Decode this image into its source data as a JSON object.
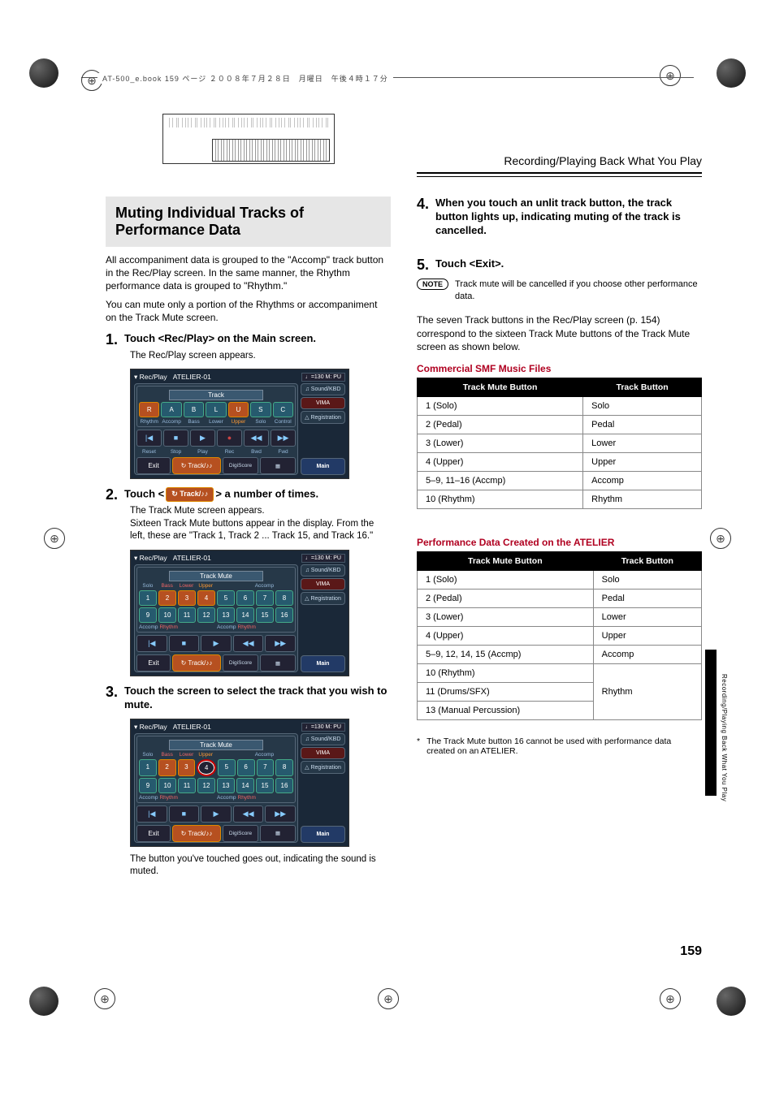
{
  "print_header": "AT-500_e.book  159 ページ  ２００８年７月２８日　月曜日　午後４時１７分",
  "running_head": "Recording/Playing Back What You Play",
  "side_tab_text": "Recording/Playing Back What You Play",
  "page_number": "159",
  "left": {
    "section_title": "Muting Individual Tracks of Performance Data",
    "intro1": "All accompaniment data is grouped to the \"Accomp\" track button in the Rec/Play screen. In the same manner, the Rhythm performance data is grouped to \"Rhythm.\"",
    "intro2": "You can mute only a portion of the Rhythms or accompaniment on the Track Mute screen.",
    "step1_text": "Touch <Rec/Play> on the Main screen.",
    "step1_sub": "The Rec/Play screen appears.",
    "step2_pre": "Touch <",
    "step2_chip": "↻ Track/♪♪",
    "step2_post": "> a number of times.",
    "step2_sub1": "The Track Mute screen appears.",
    "step2_sub2": "Sixteen Track Mute buttons appear in the display. From the left, these are \"Track 1, Track 2 ... Track 15, and Track 16.\"",
    "step3_text": "Touch the screen to select the track that you wish to mute.",
    "step3_sub": "The button you've touched goes out, indicating the sound is muted."
  },
  "right": {
    "step4_text": "When you touch an unlit track button, the track button lights up, indicating muting of the track is cancelled.",
    "step5_text": "Touch <Exit>.",
    "note_label": "NOTE",
    "note_text": "Track mute will be cancelled if you choose other performance data.",
    "mid_para": "The seven Track buttons in the Rec/Play screen (p. 154) correspond to the sixteen Track Mute buttons of the Track Mute screen as shown below.",
    "table1_title": "Commercial SMF Music Files",
    "th_mute": "Track Mute Button",
    "th_button": "Track Button",
    "t1": {
      "r1c1": "1 (Solo)",
      "r1c2": "Solo",
      "r2c1": "2 (Pedal)",
      "r2c2": "Pedal",
      "r3c1": "3 (Lower)",
      "r3c2": "Lower",
      "r4c1": "4 (Upper)",
      "r4c2": "Upper",
      "r5c1": "5–9, 11–16 (Accmp)",
      "r5c2": "Accomp",
      "r6c1": "10 (Rhythm)",
      "r6c2": "Rhythm"
    },
    "table2_title": "Performance Data Created on the ATELIER",
    "t2": {
      "r1c1": "1 (Solo)",
      "r1c2": "Solo",
      "r2c1": "2 (Pedal)",
      "r2c2": "Pedal",
      "r3c1": "3 (Lower)",
      "r3c2": "Lower",
      "r4c1": "4 (Upper)",
      "r4c2": "Upper",
      "r5c1": "5–9, 12, 14, 15 (Accmp)",
      "r5c2": "Accomp",
      "r6c1": "10 (Rhythm)",
      "r7c1": "11 (Drums/SFX)",
      "r67c2": "Rhythm",
      "r8c1": "13 (Manual Percussion)"
    },
    "foot_star": "*",
    "foot_text": "The Track Mute button 16 cannot be used with performance data created on an ATELIER."
  },
  "shot1": {
    "title_l": "Rec/Play",
    "title_r": "ATELIER-01",
    "tempo": "♩=130\nM:  PU",
    "track_label": "Track",
    "btns": [
      "R",
      "A",
      "B",
      "L",
      "U",
      "S",
      "C"
    ],
    "lbls": [
      "Rhythm",
      "Accomp",
      "Bass",
      "Lower",
      "Upper",
      "Solo",
      "Control"
    ],
    "transport_lbls": [
      "Reset",
      "Stop",
      "Play",
      "Rec",
      "Bwd",
      "Fwd"
    ],
    "exit": "Exit",
    "track_chip": "↻ Track/♪♪",
    "digi": "DigiScore",
    "side": [
      "♫ Sound/KBD",
      "VIMA",
      "△ Registration",
      "Main"
    ]
  },
  "shot2": {
    "title_l": "Rec/Play",
    "title_r": "ATELIER-01",
    "tempo": "♩=130\nM:  PU",
    "track_label": "Track Mute",
    "row1_lbls_top": [
      "Solo",
      "Bass",
      "Lower",
      "Upper",
      "",
      "",
      "Accomp",
      ""
    ],
    "nums1": [
      "1",
      "2",
      "3",
      "4",
      "5",
      "6",
      "7",
      "8"
    ],
    "nums2": [
      "9",
      "10",
      "11",
      "12",
      "13",
      "14",
      "15",
      "16"
    ],
    "row2_lbls_bot": [
      "Accomp",
      "Rhythm",
      "",
      "",
      "Accomp",
      "Rhythm",
      "",
      ""
    ],
    "exit": "Exit",
    "track_chip": "↻ Track/♪♪",
    "digi": "DigiScore",
    "side": [
      "♫ Sound/KBD",
      "VIMA",
      "△ Registration",
      "Main"
    ]
  }
}
